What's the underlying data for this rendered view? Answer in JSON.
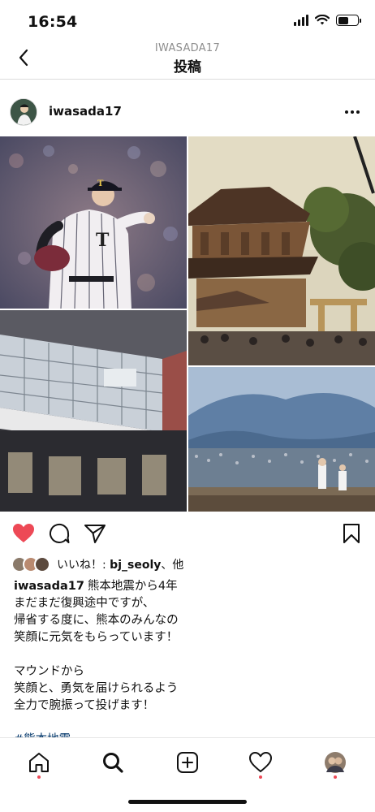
{
  "status": {
    "time": "16:54",
    "battery_level": 0.55
  },
  "nav": {
    "subtitle": "IWASADA17",
    "title": "投稿",
    "back_icon": "chevron-left-icon"
  },
  "post": {
    "username": "iwasada17",
    "more_icon": "more-horizontal-icon"
  },
  "photo_tiles": [
    {
      "name": "pitcher-photo",
      "description_icon": "baseball-pitcher-image"
    },
    {
      "name": "shrine-gate-photo",
      "description_icon": "shrine-image"
    },
    {
      "name": "station-building-photo",
      "description_icon": "building-image"
    },
    {
      "name": "stadium-mountain-photo",
      "description_icon": "stadium-image"
    }
  ],
  "actions": {
    "like_icon": "heart-filled-icon",
    "comment_icon": "comment-icon",
    "share_icon": "send-icon",
    "save_icon": "bookmark-icon",
    "like_color": "#ed4956"
  },
  "likes": {
    "prefix": "いいね！: ",
    "user": "bj_seoly",
    "suffix": "、他"
  },
  "caption": {
    "username": "iwasada17",
    "lines": [
      "熊本地震から4年",
      "まだまだ復興途中ですが、",
      "帰省する度に、熊本のみんなの",
      "笑顔に元気をもらっています！",
      "",
      "マウンドから",
      "笑顔と、勇気を届けられるよう",
      "全力で腕振って投げます！",
      "",
      "#熊本地震"
    ]
  },
  "tabbar": {
    "items": [
      {
        "name": "home",
        "icon": "home-icon",
        "has_dot": true
      },
      {
        "name": "search",
        "icon": "search-icon",
        "has_dot": false
      },
      {
        "name": "new-post",
        "icon": "plus-square-icon",
        "has_dot": false
      },
      {
        "name": "activity",
        "icon": "heart-outline-icon",
        "has_dot": true
      },
      {
        "name": "profile",
        "icon": "profile-avatar",
        "has_dot": true
      }
    ]
  },
  "colors": {
    "accent_dot": "#ed4956",
    "hashtag": "#003569",
    "secondary_text": "#8e8e8e"
  }
}
